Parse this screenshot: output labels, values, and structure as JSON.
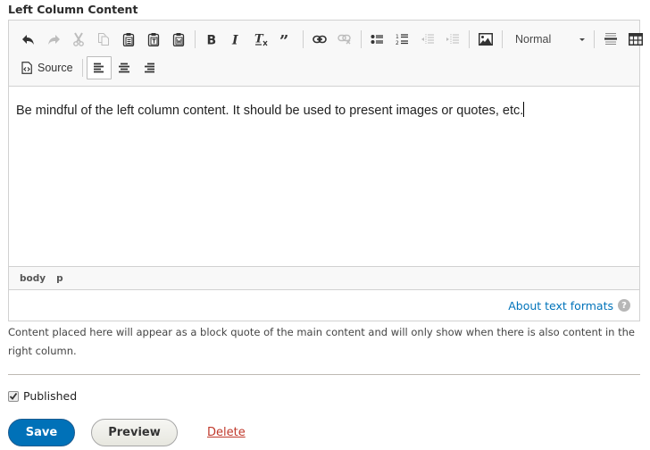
{
  "field": {
    "label": "Left Column Content"
  },
  "toolbar": {
    "row1": [
      {
        "name": "undo-button",
        "icon": "undo-icon",
        "disabled": false
      },
      {
        "name": "redo-button",
        "icon": "redo-icon",
        "disabled": true
      },
      {
        "name": "cut-button",
        "icon": "cut-icon",
        "disabled": true
      },
      {
        "name": "copy-button",
        "icon": "copy-icon",
        "disabled": true
      },
      {
        "name": "paste-button",
        "icon": "paste-icon",
        "disabled": false
      },
      {
        "name": "paste-text-button",
        "icon": "paste-text-icon",
        "disabled": false
      },
      {
        "name": "paste-word-button",
        "icon": "paste-word-icon",
        "disabled": false
      },
      {
        "name": "bold-button",
        "icon": "bold-icon",
        "disabled": false
      },
      {
        "name": "italic-button",
        "icon": "italic-icon",
        "disabled": false
      },
      {
        "name": "remove-format-button",
        "icon": "remove-format-icon",
        "disabled": false
      },
      {
        "name": "blockquote-button",
        "icon": "blockquote-icon",
        "disabled": false
      },
      {
        "name": "link-button",
        "icon": "link-icon",
        "disabled": false
      },
      {
        "name": "unlink-button",
        "icon": "unlink-icon",
        "disabled": true
      },
      {
        "name": "bulleted-list-button",
        "icon": "bulleted-list-icon",
        "disabled": false
      },
      {
        "name": "numbered-list-button",
        "icon": "numbered-list-icon",
        "disabled": false
      },
      {
        "name": "outdent-button",
        "icon": "outdent-icon",
        "disabled": true
      },
      {
        "name": "indent-button",
        "icon": "indent-icon",
        "disabled": true
      },
      {
        "name": "image-button",
        "icon": "image-icon",
        "disabled": false
      },
      {
        "name": "horizontal-rule-button",
        "icon": "horizontal-rule-icon",
        "disabled": false
      },
      {
        "name": "table-button",
        "icon": "table-icon",
        "disabled": false
      }
    ],
    "format_select": {
      "value": "Normal"
    },
    "source_label": "Source",
    "align": [
      {
        "name": "align-left-button",
        "icon": "align-left-icon",
        "active": true
      },
      {
        "name": "align-center-button",
        "icon": "align-center-icon",
        "active": false
      },
      {
        "name": "align-right-button",
        "icon": "align-right-icon",
        "active": false
      }
    ]
  },
  "content": {
    "text": "Be mindful of the left column content. It should be used to present images or quotes, etc."
  },
  "path_bar": {
    "items": [
      "body",
      "p"
    ]
  },
  "formats": {
    "link_label": "About text formats",
    "help_glyph": "?"
  },
  "description": "Content placed here will appear as a block quote of the main content and will only show when there is also content in the right column.",
  "published": {
    "label": "Published",
    "checked": true
  },
  "actions": {
    "save_label": "Save",
    "preview_label": "Preview",
    "delete_label": "Delete"
  },
  "colors": {
    "primary": "#0071b8",
    "link": "#0073ba",
    "danger": "#c0392b"
  }
}
